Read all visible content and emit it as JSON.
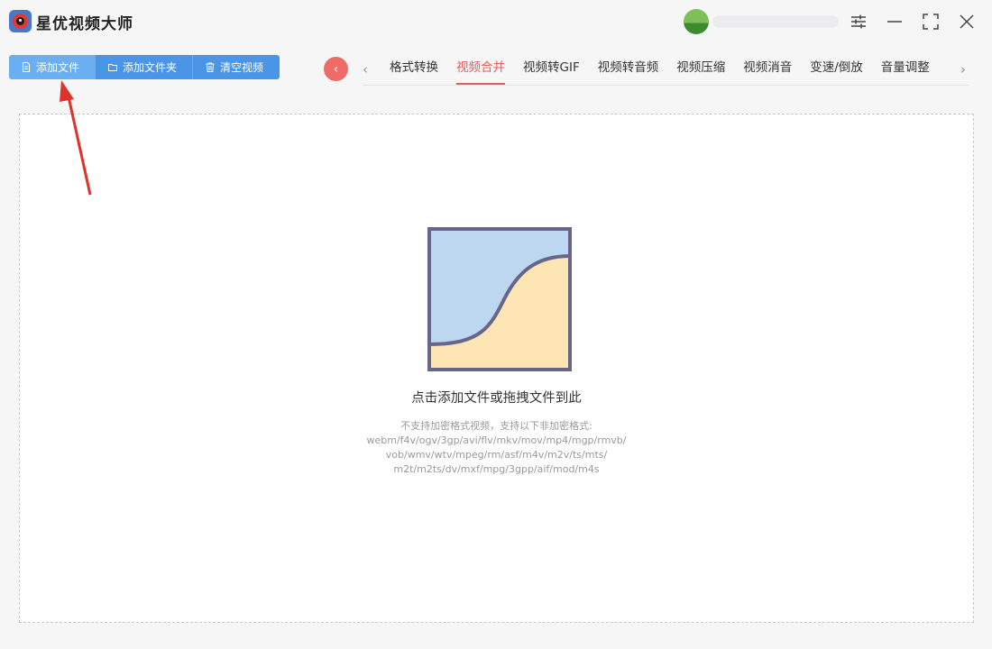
{
  "app": {
    "title": "星优视频大师"
  },
  "toolbar": {
    "add_file": "添加文件",
    "add_folder": "添加文件夹",
    "clear_videos": "清空视频"
  },
  "tabs": [
    {
      "label": "格式转换"
    },
    {
      "label": "视频合并"
    },
    {
      "label": "视频转GIF"
    },
    {
      "label": "视频转音频"
    },
    {
      "label": "视频压缩"
    },
    {
      "label": "视频消音"
    },
    {
      "label": "变速/倒放"
    },
    {
      "label": "音量调整"
    }
  ],
  "active_tab": "视频合并",
  "dropzone": {
    "title": "点击添加文件或拖拽文件到此",
    "formats": [
      "不支持加密格式视频，支持以下非加密格式:",
      "webm/f4v/ogv/3gp/avi/flv/mkv/mov/mp4/mgp/rmvb/",
      "vob/wmv/wtv/mpeg/rm/asf/m4v/m2v/ts/mts/",
      "m2t/m2ts/dv/mxf/mpg/3gpp/aif/mod/m4s"
    ]
  },
  "colors": {
    "accent": "#e25e5a",
    "primary_button": "#4a95e6",
    "primary_button_active": "#6ab0f0",
    "annotation_arrow": "#e0312b"
  }
}
